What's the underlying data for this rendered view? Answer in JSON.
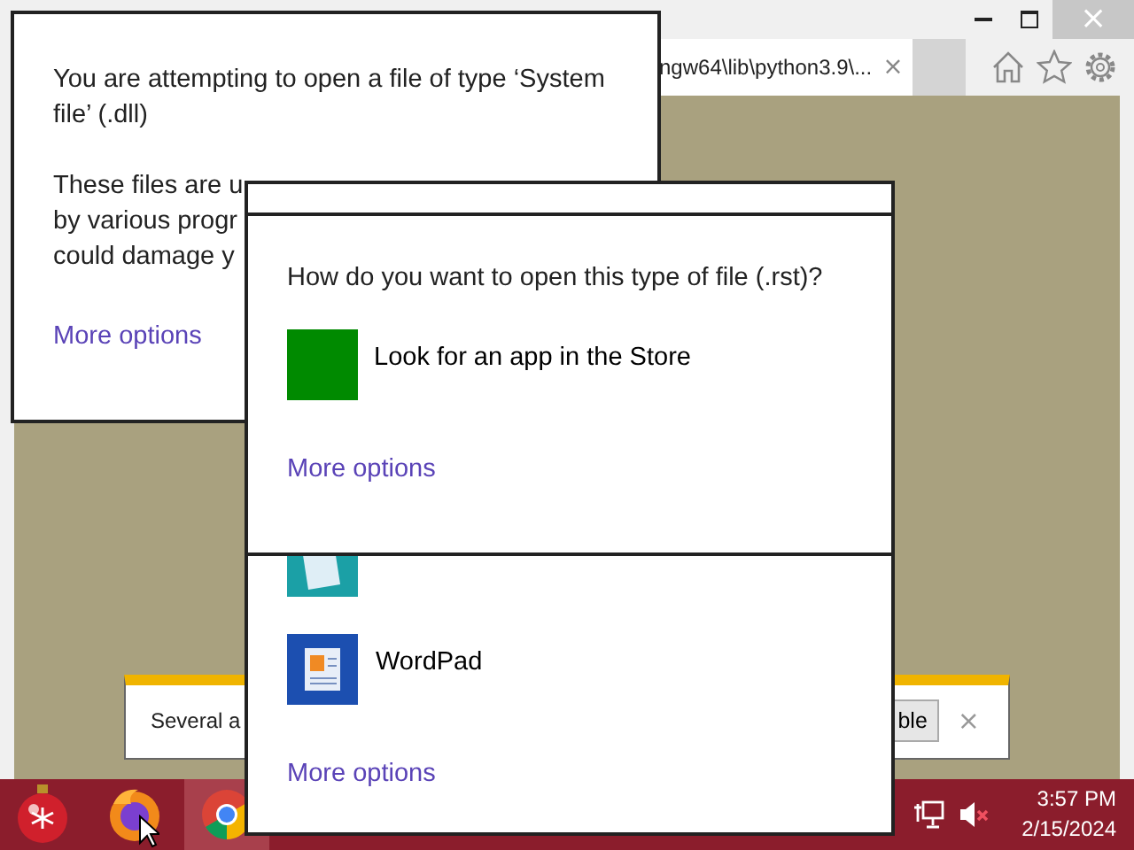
{
  "browser": {
    "tab": {
      "title": "ngw64\\lib\\python3.9\\...",
      "close": "×"
    },
    "close": "×"
  },
  "notification": {
    "text": "Several a",
    "button": "ble",
    "close": "×"
  },
  "file_type_dialog": {
    "message": "You are attempting to open a file of type ‘System file’ (.dll)",
    "visible_lines": [
      "These files are u",
      "by various progr",
      "could damage y"
    ],
    "more_options": "More options"
  },
  "open_with_dialog": {
    "question": "How do you want to open this type of file (.rst)?",
    "store_option": {
      "label": "Look for an app in the Store"
    },
    "store_more_options": "More options",
    "apps": [
      {
        "kind": "notepad"
      },
      {
        "kind": "wordpad",
        "label": "WordPad"
      }
    ],
    "more_options": "More options"
  },
  "taskbar": {
    "apps": [
      {
        "kind": "ornament",
        "selected": false
      },
      {
        "kind": "firefox",
        "selected": false
      },
      {
        "kind": "chrome",
        "selected": true
      }
    ],
    "clock": {
      "time": "3:57 PM",
      "date": "2/15/2024"
    }
  }
}
